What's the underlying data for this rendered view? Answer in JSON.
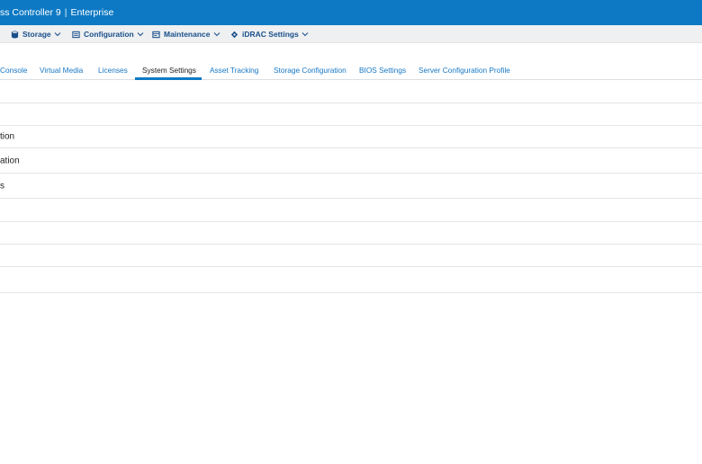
{
  "titlebar": {
    "product": "ss Controller 9",
    "separator": "|",
    "edition": "Enterprise"
  },
  "menu": [
    {
      "label": "Storage",
      "icon": "database-icon"
    },
    {
      "label": "Configuration",
      "icon": "config-icon"
    },
    {
      "label": "Maintenance",
      "icon": "maintenance-icon"
    },
    {
      "label": "iDRAC Settings",
      "icon": "idrac-settings-icon"
    }
  ],
  "tabs": [
    {
      "label": "Console"
    },
    {
      "label": "Virtual Media"
    },
    {
      "label": "Licenses"
    },
    {
      "label": "System Settings",
      "active": true
    },
    {
      "label": "Asset Tracking"
    },
    {
      "label": "Storage Configuration"
    },
    {
      "label": "BIOS Settings"
    },
    {
      "label": "Server Configuration Profile"
    }
  ],
  "rows": [
    "",
    "",
    "tion",
    "ation",
    "s",
    "",
    "",
    "",
    ""
  ],
  "colors": {
    "titlebar": "#0d79c4",
    "menubar": "#eef0f2",
    "link": "#1677c4",
    "menu_text": "#1a4f8a"
  }
}
